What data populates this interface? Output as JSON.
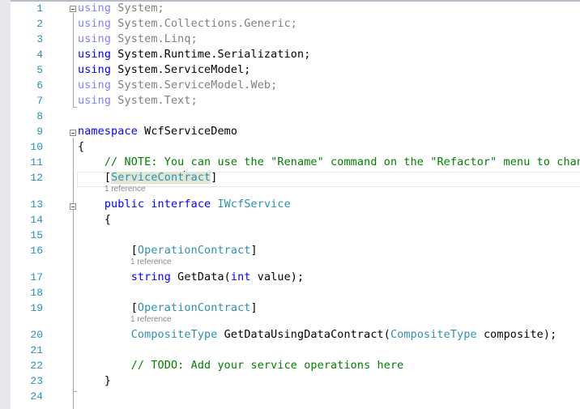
{
  "editor": {
    "language": "C#",
    "lines": [
      {
        "n": "1",
        "tokens": [
          {
            "t": "using",
            "c": "kwdim"
          },
          {
            "t": " System;",
            "c": "dim"
          }
        ]
      },
      {
        "n": "2",
        "tokens": [
          {
            "t": "using",
            "c": "kwdim"
          },
          {
            "t": " System.Collections.Generic;",
            "c": "dim"
          }
        ]
      },
      {
        "n": "3",
        "tokens": [
          {
            "t": "using",
            "c": "kwdim"
          },
          {
            "t": " System.Linq;",
            "c": "dim"
          }
        ]
      },
      {
        "n": "4",
        "tokens": [
          {
            "t": "using",
            "c": "kw"
          },
          {
            "t": " System.Runtime.Serialization;",
            "c": ""
          }
        ]
      },
      {
        "n": "5",
        "tokens": [
          {
            "t": "using",
            "c": "kw"
          },
          {
            "t": " System.ServiceModel;",
            "c": ""
          }
        ]
      },
      {
        "n": "6",
        "tokens": [
          {
            "t": "using",
            "c": "kwdim"
          },
          {
            "t": " System.ServiceModel.Web;",
            "c": "dim"
          }
        ]
      },
      {
        "n": "7",
        "tokens": [
          {
            "t": "using",
            "c": "kwdim"
          },
          {
            "t": " System.Text;",
            "c": "dim"
          }
        ]
      },
      {
        "n": "8",
        "tokens": []
      },
      {
        "n": "9",
        "tokens": [
          {
            "t": "namespace",
            "c": "kw"
          },
          {
            "t": " WcfServiceDemo",
            "c": ""
          }
        ]
      },
      {
        "n": "10",
        "tokens": [
          {
            "t": "{",
            "c": ""
          }
        ]
      },
      {
        "n": "11",
        "tokens": [
          {
            "t": "    // NOTE: You can use the \"Rename\" command on the \"Refactor\" menu to change",
            "c": "cm"
          }
        ]
      },
      {
        "n": "12",
        "tokens": [
          {
            "t": "    [",
            "c": ""
          },
          {
            "t": "ServiceCont",
            "c": "ty hl"
          },
          {
            "t": "CARET",
            "c": "caret"
          },
          {
            "t": "ract",
            "c": "ty hl"
          },
          {
            "t": "]",
            "c": ""
          }
        ],
        "lens": "1 reference"
      },
      {
        "n": "13",
        "tokens": [
          {
            "t": "    public interface",
            "c": "kw"
          },
          {
            "t": " ",
            "c": ""
          },
          {
            "t": "IWcfService",
            "c": "ty"
          }
        ]
      },
      {
        "n": "14",
        "tokens": [
          {
            "t": "    {",
            "c": ""
          }
        ]
      },
      {
        "n": "15",
        "tokens": []
      },
      {
        "n": "16",
        "tokens": [
          {
            "t": "        [",
            "c": ""
          },
          {
            "t": "OperationContract",
            "c": "ty"
          },
          {
            "t": "]",
            "c": ""
          }
        ],
        "lens": "1 reference"
      },
      {
        "n": "17",
        "tokens": [
          {
            "t": "        string",
            "c": "kw"
          },
          {
            "t": " GetData(",
            "c": ""
          },
          {
            "t": "int",
            "c": "kw"
          },
          {
            "t": " value);",
            "c": ""
          }
        ]
      },
      {
        "n": "18",
        "tokens": []
      },
      {
        "n": "19",
        "tokens": [
          {
            "t": "        [",
            "c": ""
          },
          {
            "t": "OperationContract",
            "c": "ty"
          },
          {
            "t": "]",
            "c": ""
          }
        ],
        "lens": "1 reference"
      },
      {
        "n": "20",
        "tokens": [
          {
            "t": "        ",
            "c": ""
          },
          {
            "t": "CompositeType",
            "c": "ty"
          },
          {
            "t": " GetDataUsingDataContract(",
            "c": ""
          },
          {
            "t": "CompositeType",
            "c": "ty"
          },
          {
            "t": " composite);",
            "c": ""
          }
        ]
      },
      {
        "n": "21",
        "tokens": []
      },
      {
        "n": "22",
        "tokens": [
          {
            "t": "        // TODO: Add your service operations here",
            "c": "cm"
          }
        ]
      },
      {
        "n": "23",
        "tokens": [
          {
            "t": "    }",
            "c": ""
          }
        ]
      },
      {
        "n": "24",
        "tokens": []
      }
    ]
  }
}
